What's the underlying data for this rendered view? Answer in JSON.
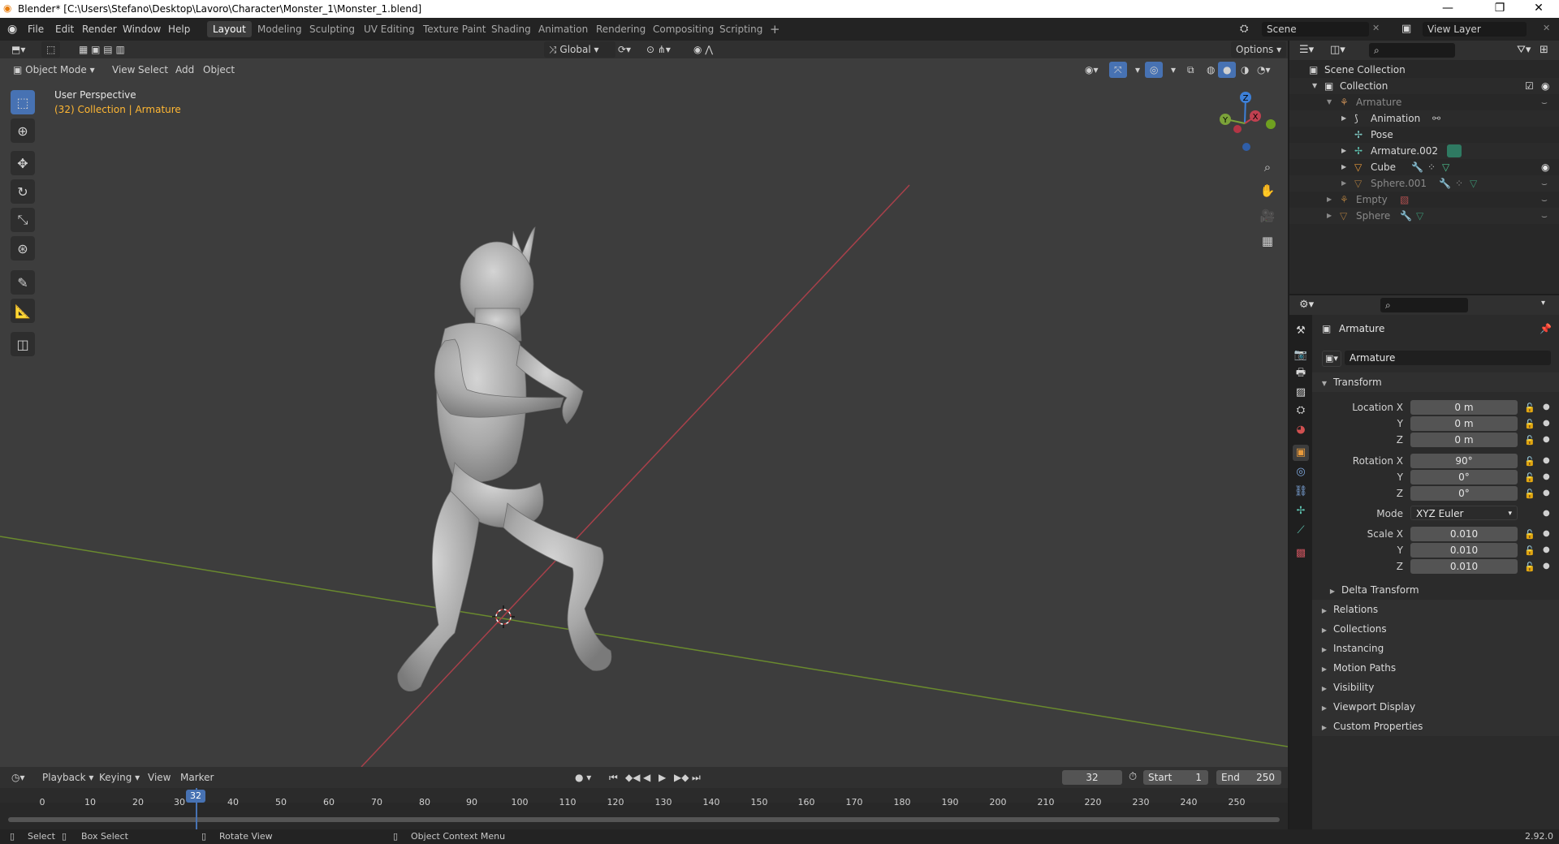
{
  "window": {
    "title": "Blender* [C:\\Users\\Stefano\\Desktop\\Lavoro\\Character\\Monster_1\\Monster_1.blend]"
  },
  "menu": {
    "items": [
      "File",
      "Edit",
      "Render",
      "Window",
      "Help"
    ]
  },
  "workspaces": {
    "tabs": [
      "Layout",
      "Modeling",
      "Sculpting",
      "UV Editing",
      "Texture Paint",
      "Shading",
      "Animation",
      "Rendering",
      "Compositing",
      "Scripting"
    ],
    "active": "Layout",
    "add": "+"
  },
  "scene": {
    "label": "Scene",
    "view_layer": "View Layer"
  },
  "viewport": {
    "mode": "Object Mode",
    "menus": [
      "View",
      "Select",
      "Add",
      "Object"
    ],
    "transform_orientation": "Global",
    "options_label": "Options",
    "overlay_title": "User Perspective",
    "overlay_subtitle": "(32) Collection | Armature",
    "gizmo": {
      "z": "Z",
      "y": "Y",
      "x": "X"
    }
  },
  "outliner": {
    "scene_collection": "Scene Collection",
    "rows": [
      {
        "label": "Collection"
      },
      {
        "label": "Armature"
      },
      {
        "label": "Animation"
      },
      {
        "label": "Pose"
      },
      {
        "label": "Armature.002"
      },
      {
        "label": "Cube"
      },
      {
        "label": "Sphere.001"
      },
      {
        "label": "Empty"
      },
      {
        "label": "Sphere"
      }
    ]
  },
  "properties": {
    "object_name": "Armature",
    "name_field": "Armature",
    "transform_title": "Transform",
    "location": {
      "label": "Location X",
      "y_label": "Y",
      "z_label": "Z",
      "x": "0 m",
      "y": "0 m",
      "z": "0 m"
    },
    "rotation": {
      "label": "Rotation X",
      "y_label": "Y",
      "z_label": "Z",
      "x": "90°",
      "y": "0°",
      "z": "0°"
    },
    "mode": {
      "label": "Mode",
      "value": "XYZ Euler"
    },
    "scale": {
      "label": "Scale X",
      "y_label": "Y",
      "z_label": "Z",
      "x": "0.010",
      "y": "0.010",
      "z": "0.010"
    },
    "delta_transform": "Delta Transform",
    "sections": [
      "Relations",
      "Collections",
      "Instancing",
      "Motion Paths",
      "Visibility",
      "Viewport Display",
      "Custom Properties"
    ]
  },
  "timeline": {
    "menus": [
      "Playback",
      "Keying",
      "View",
      "Marker"
    ],
    "current_frame": "32",
    "start_label": "Start",
    "start": "1",
    "end_label": "End",
    "end": "250",
    "ticks": [
      "0",
      "10",
      "20",
      "30",
      "40",
      "50",
      "60",
      "70",
      "80",
      "90",
      "100",
      "110",
      "120",
      "130",
      "140",
      "150",
      "160",
      "170",
      "180",
      "190",
      "200",
      "210",
      "220",
      "230",
      "240",
      "250"
    ]
  },
  "status": {
    "select": "Select",
    "box_select": "Box Select",
    "rotate_view": "Rotate View",
    "context_menu": "Object Context Menu",
    "version": "2.92.0"
  },
  "colors": {
    "accent": "#4772b3",
    "active_text": "#ffb733",
    "x_axis": "#c04050",
    "y_axis": "#7ba239",
    "z_axis": "#3d80d8"
  }
}
